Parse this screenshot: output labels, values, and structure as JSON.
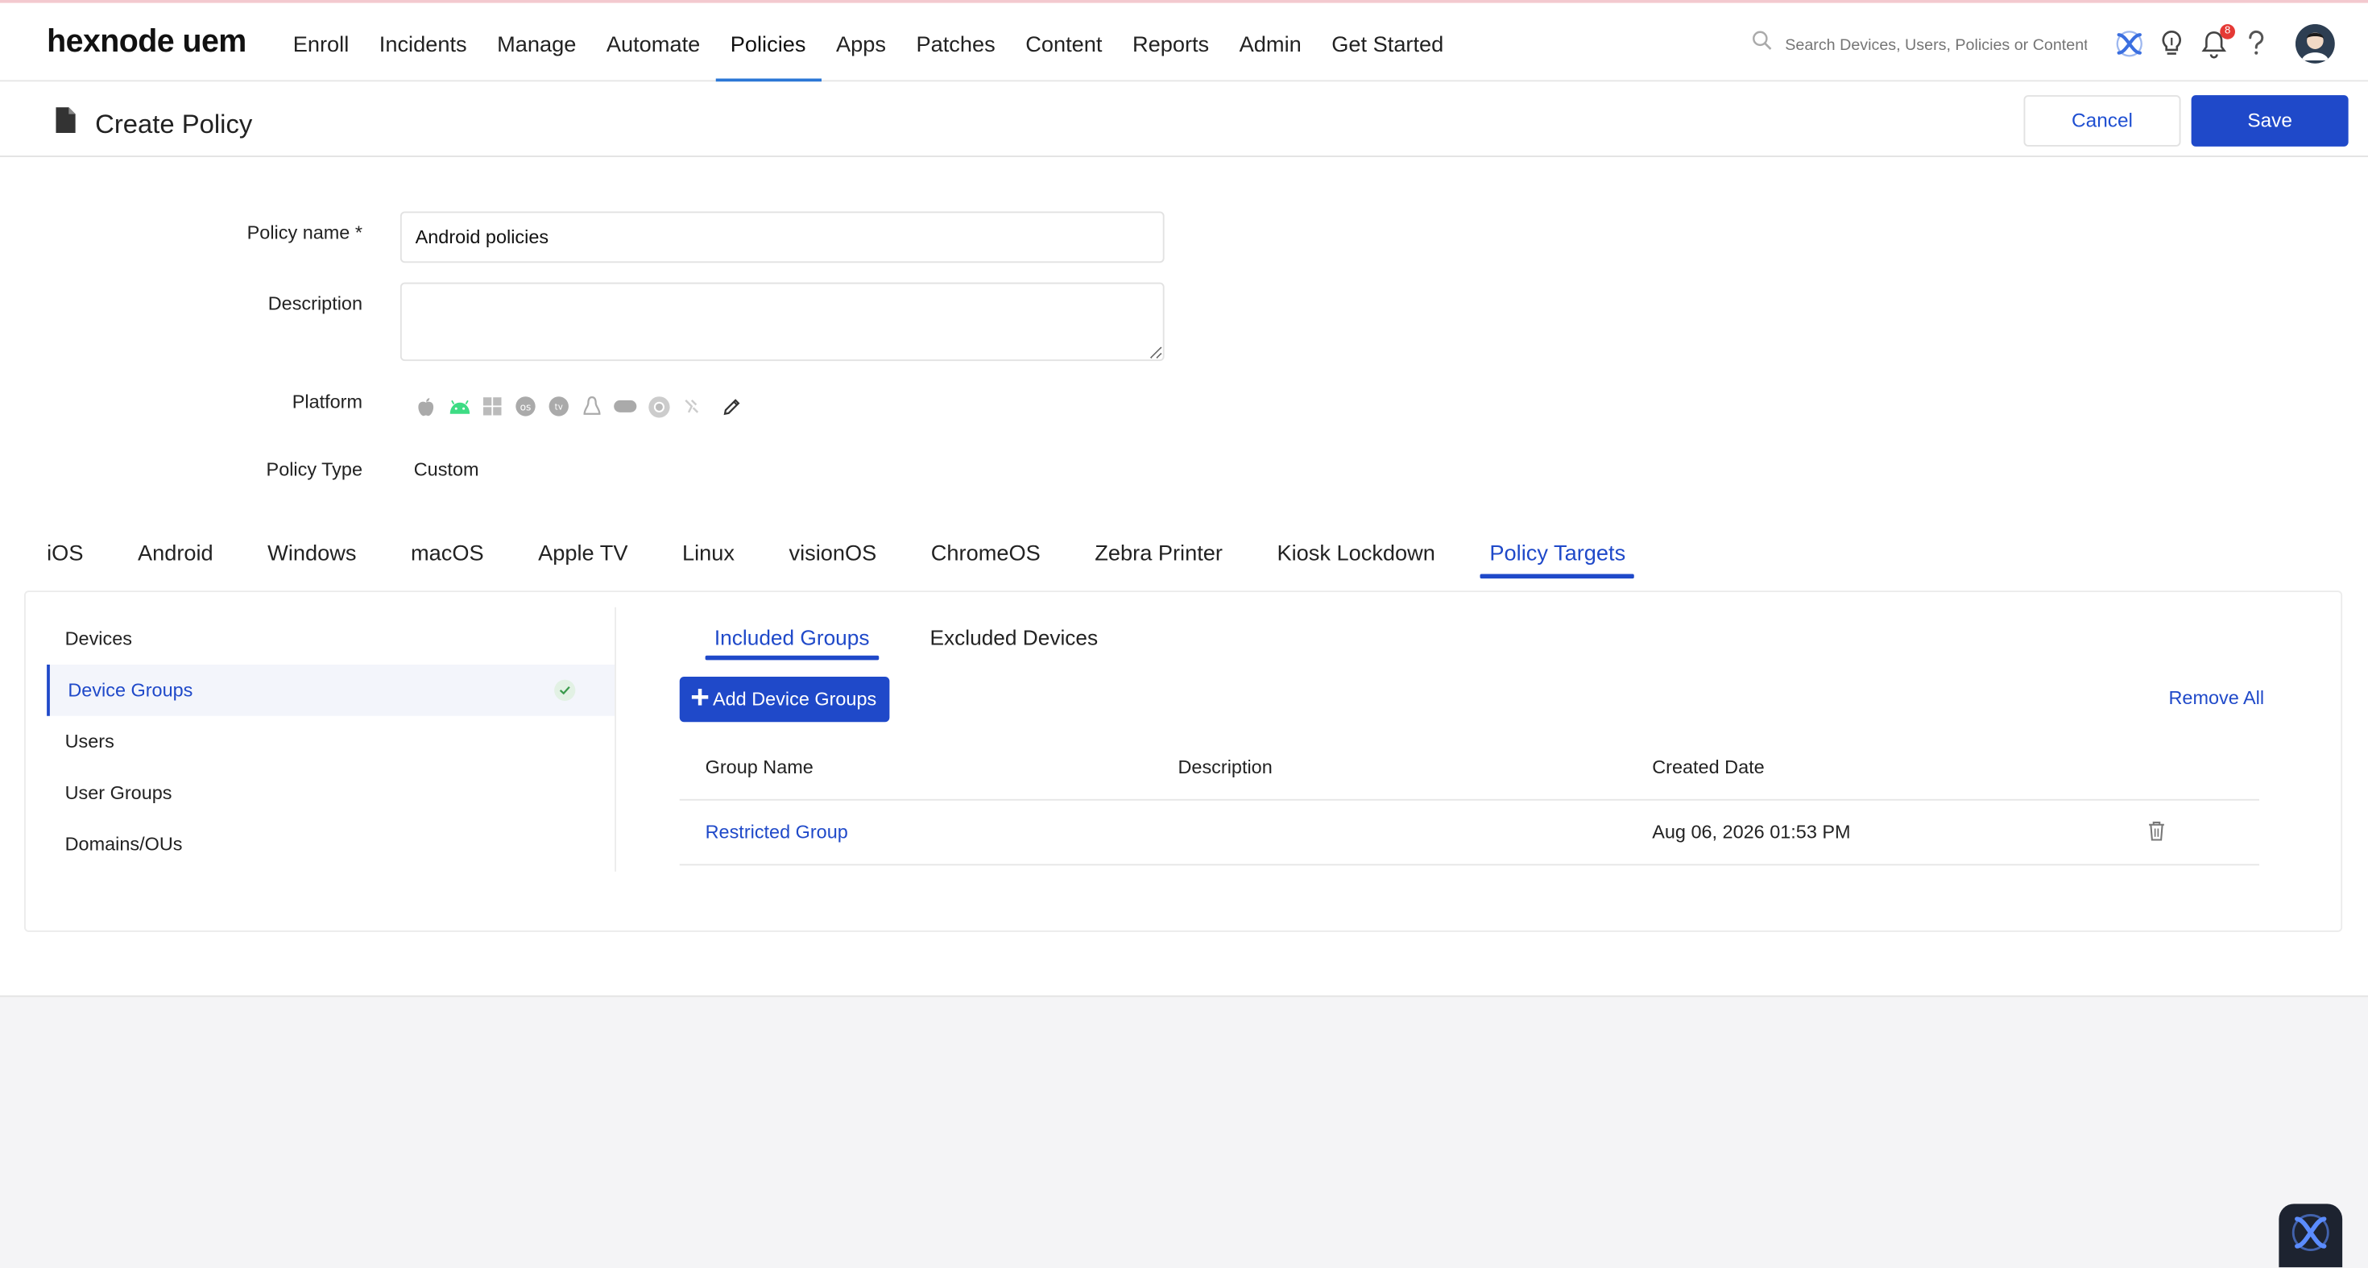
{
  "app": {
    "logo": "hexnode uem"
  },
  "nav": {
    "items": [
      {
        "label": "Enroll"
      },
      {
        "label": "Incidents"
      },
      {
        "label": "Manage"
      },
      {
        "label": "Automate"
      },
      {
        "label": "Policies",
        "active": true
      },
      {
        "label": "Apps"
      },
      {
        "label": "Patches"
      },
      {
        "label": "Content"
      },
      {
        "label": "Reports"
      },
      {
        "label": "Admin"
      },
      {
        "label": "Get Started"
      }
    ],
    "search_placeholder": "Search Devices, Users, Policies or Content",
    "notification_count": "8"
  },
  "header": {
    "title": "Create Policy",
    "cancel_label": "Cancel",
    "save_label": "Save"
  },
  "form": {
    "policy_name_label": "Policy name *",
    "policy_name_value": "Android policies",
    "description_label": "Description",
    "description_value": "",
    "platform_label": "Platform",
    "platforms": [
      "apple-icon",
      "android-icon",
      "windows-icon",
      "macos-icon",
      "appletv-icon",
      "linux-icon",
      "visionos-icon",
      "chromeos-icon",
      "zebra-icon",
      "edit-icon"
    ],
    "policy_type_label": "Policy Type",
    "policy_type_value": "Custom"
  },
  "platform_tabs": [
    {
      "label": "iOS"
    },
    {
      "label": "Android"
    },
    {
      "label": "Windows"
    },
    {
      "label": "macOS"
    },
    {
      "label": "Apple TV"
    },
    {
      "label": "Linux"
    },
    {
      "label": "visionOS"
    },
    {
      "label": "ChromeOS"
    },
    {
      "label": "Zebra Printer"
    },
    {
      "label": "Kiosk Lockdown"
    },
    {
      "label": "Policy Targets",
      "active": true
    }
  ],
  "targets": {
    "side_items": [
      {
        "label": "Devices"
      },
      {
        "label": "Device Groups",
        "active": true
      },
      {
        "label": "Users"
      },
      {
        "label": "User Groups"
      },
      {
        "label": "Domains/OUs"
      }
    ],
    "subtabs": [
      {
        "label": "Included Groups",
        "active": true
      },
      {
        "label": "Excluded Devices"
      }
    ],
    "add_button_label": "Add Device Groups",
    "remove_all_label": "Remove All",
    "columns": [
      "Group Name",
      "Description",
      "Created Date"
    ],
    "rows": [
      {
        "group_name": "Restricted Group",
        "description": "",
        "created_date": "Aug 06, 2026 01:53 PM"
      }
    ]
  },
  "colors": {
    "accent": "#1f49c9",
    "nav_underline": "#2b77d6",
    "android_green": "#3ddc84"
  }
}
